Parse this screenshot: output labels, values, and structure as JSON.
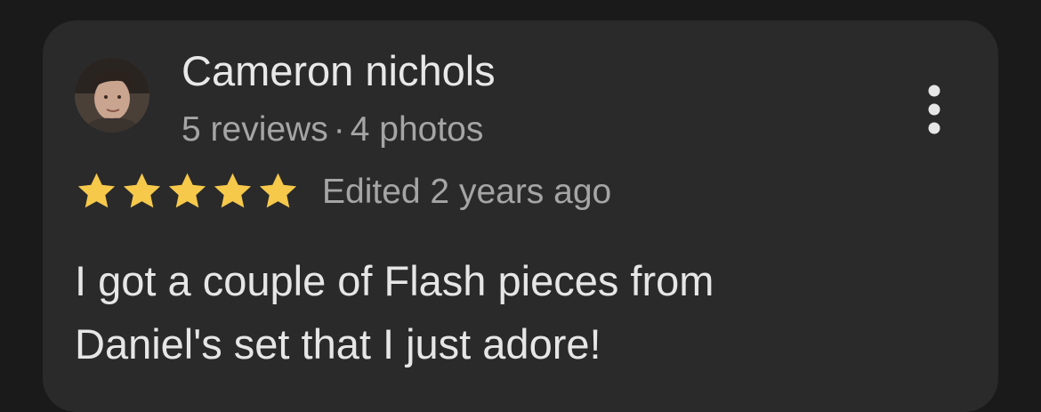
{
  "review": {
    "author_name": "Cameron nichols",
    "reviews_count": "5 reviews",
    "separator": "·",
    "photos_count": "4 photos",
    "rating": 5,
    "rating_max": 5,
    "edited_label": "Edited 2 years ago",
    "text": "I got a couple of Flash pieces from\nDaniel's set that I just adore!"
  },
  "icons": {
    "avatar": "avatar-photo",
    "star": "star-icon",
    "more": "more-vertical-icon"
  },
  "colors": {
    "background": "#1a1a1a",
    "card": "#2a2a2b",
    "star": "#f6c94b",
    "primary_text": "#e8e8e8",
    "secondary_text": "#a5a5a5"
  }
}
